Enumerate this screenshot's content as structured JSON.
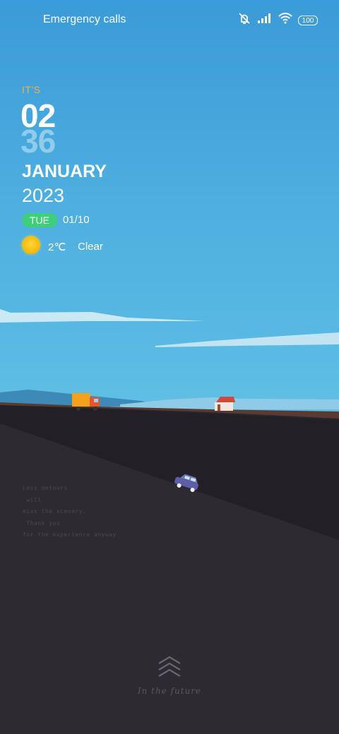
{
  "status_bar": {
    "left_text": "Emergency calls",
    "battery": "100",
    "icons": [
      "mute-icon",
      "signal-icon",
      "wifi-icon",
      "battery-icon"
    ]
  },
  "clock": {
    "prefix": "IT'S",
    "hour": "02",
    "minute": "36",
    "month": "JANUARY",
    "year": "2023",
    "weekday": "TUE",
    "date": "01/10"
  },
  "weather": {
    "icon": "sun-icon",
    "temperature": "2℃",
    "condition": "Clear"
  },
  "poem": {
    "lines": [
      "Less detours",
      " will",
      "miss the scenery,",
      " Thank you",
      "for the experience anyway"
    ]
  },
  "footer": {
    "unlock_icon": "chevrons-up-icon",
    "caption": "In the future"
  },
  "colors": {
    "sky": "#5bbbe3",
    "ground": "#2a262d",
    "accent_orange": "#f2b04a",
    "badge_green": "#3ecf7a"
  }
}
